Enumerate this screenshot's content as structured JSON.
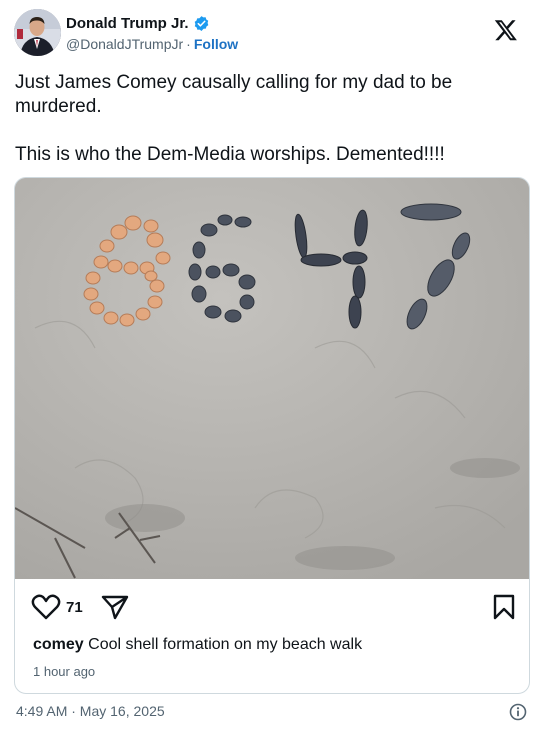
{
  "author": {
    "display_name": "Donald Trump Jr.",
    "handle": "@DonaldJTrumpJr",
    "separator": "·",
    "follow_label": "Follow",
    "verified": true
  },
  "tweet": {
    "paragraphs": [
      "Just James Comey causally calling for my dad to be murdered.",
      "This is who the Dem-Media worships. Demented!!!!"
    ],
    "timestamp": "4:49 AM · May 16, 2025"
  },
  "embed": {
    "like_count": "71",
    "caption_user": "comey",
    "caption_text": "Cool shell formation on my beach walk",
    "time_ago": "1 hour ago",
    "photo_text": "8647"
  },
  "colors": {
    "text": "#0f1419",
    "muted": "#536471",
    "follow": "#1d72c4",
    "verified": "#1d9bf0",
    "border": "#cfd9de",
    "sand": "#b9b7b3"
  },
  "icons": [
    "x-logo-icon",
    "verified-badge-icon",
    "heart-icon",
    "send-icon",
    "bookmark-icon",
    "info-icon"
  ]
}
